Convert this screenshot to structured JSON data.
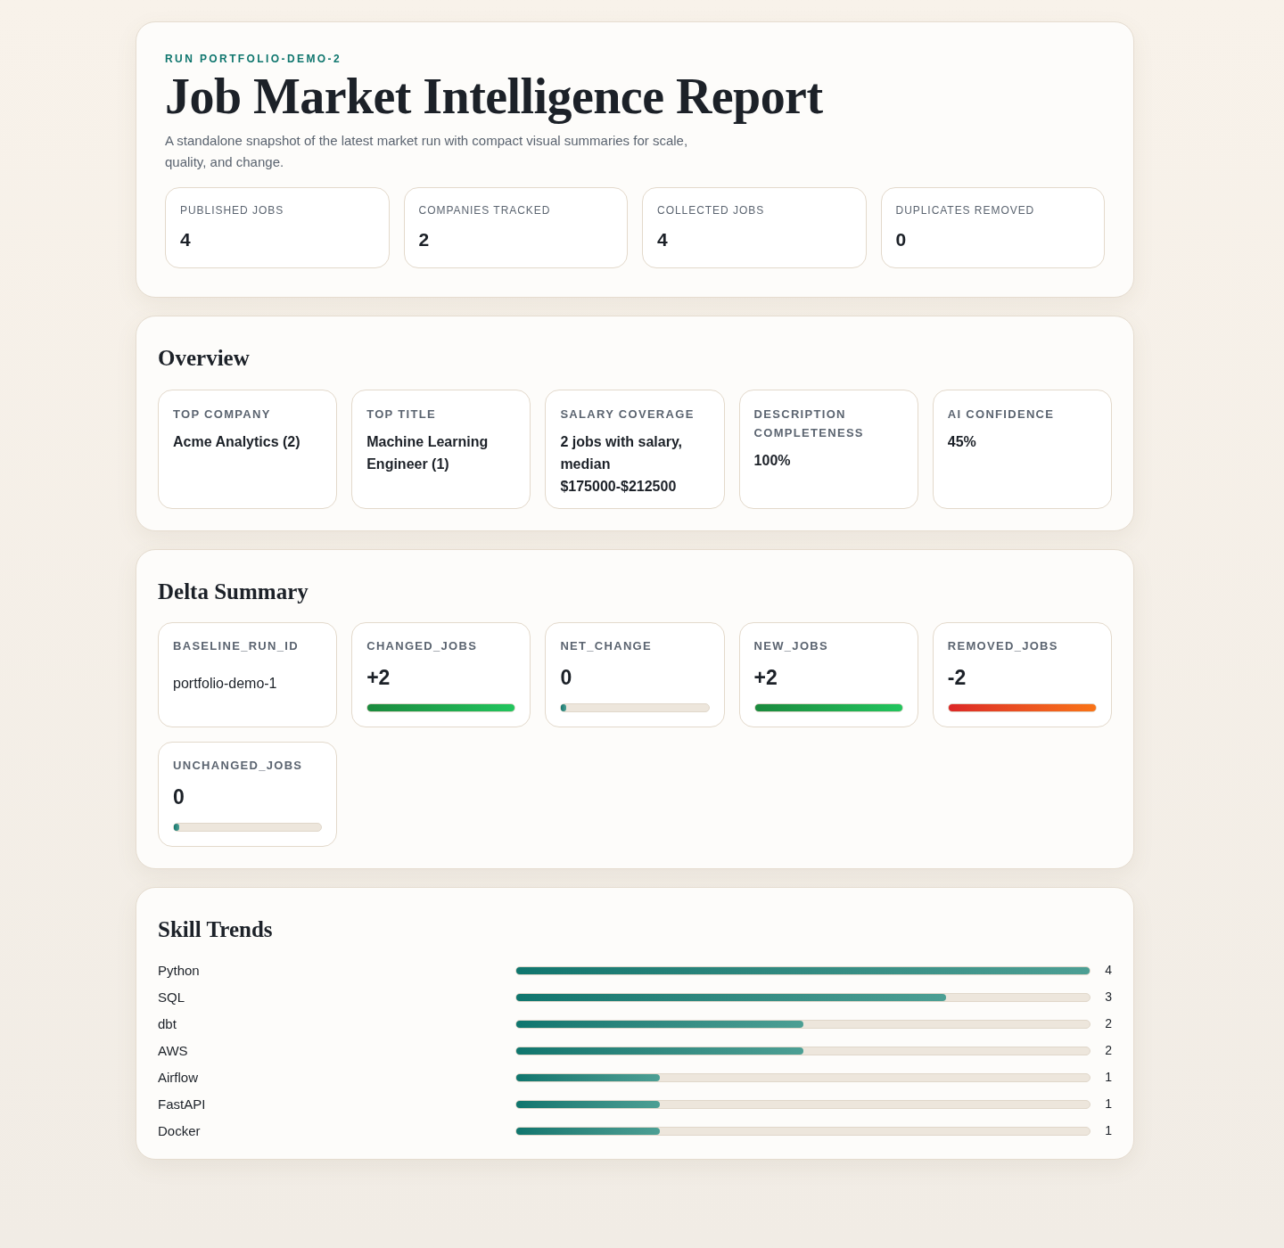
{
  "header": {
    "eyebrow": "RUN PORTFOLIO-DEMO-2",
    "title": "Job Market Intelligence Report",
    "description": "A standalone snapshot of the latest market run with compact visual summaries for scale, quality, and change.",
    "stats": [
      {
        "label": "PUBLISHED JOBS",
        "value": "4"
      },
      {
        "label": "COMPANIES TRACKED",
        "value": "2"
      },
      {
        "label": "COLLECTED JOBS",
        "value": "4"
      },
      {
        "label": "DUPLICATES REMOVED",
        "value": "0"
      }
    ]
  },
  "overview": {
    "title": "Overview",
    "cards": [
      {
        "label": "TOP COMPANY",
        "value": "Acme Analytics (2)"
      },
      {
        "label": "TOP TITLE",
        "value": "Machine Learning Engineer (1)"
      },
      {
        "label": "SALARY COVERAGE",
        "value": "2 jobs with salary, median $175000-$212500"
      },
      {
        "label": "DESCRIPTION COMPLETENESS",
        "value": "100%"
      },
      {
        "label": "AI CONFIDENCE",
        "value": "45%"
      }
    ]
  },
  "delta": {
    "title": "Delta Summary",
    "cards": [
      {
        "label": "BASELINE_RUN_ID",
        "value": "portfolio-demo-1",
        "kind": "text"
      },
      {
        "label": "CHANGED_JOBS",
        "value": "+2",
        "kind": "positive",
        "level": 1
      },
      {
        "label": "NET_CHANGE",
        "value": "0",
        "kind": "neutral",
        "level": 0
      },
      {
        "label": "NEW_JOBS",
        "value": "+2",
        "kind": "positive",
        "level": 1
      },
      {
        "label": "REMOVED_JOBS",
        "value": "-2",
        "kind": "negative",
        "level": 1
      },
      {
        "label": "UNCHANGED_JOBS",
        "value": "0",
        "kind": "neutral",
        "level": 0
      }
    ]
  },
  "skills": {
    "title": "Skill Trends",
    "rows": [
      {
        "name": "Python",
        "count": "4",
        "level": 1
      },
      {
        "name": "SQL",
        "count": "3",
        "level": 0.75
      },
      {
        "name": "dbt",
        "count": "2",
        "level": 0.5
      },
      {
        "name": "AWS",
        "count": "2",
        "level": 0.5
      },
      {
        "name": "Airflow",
        "count": "1",
        "level": 0.25
      },
      {
        "name": "FastAPI",
        "count": "1",
        "level": 0.25
      },
      {
        "name": "Docker",
        "count": "1",
        "level": 0.25
      }
    ]
  }
}
